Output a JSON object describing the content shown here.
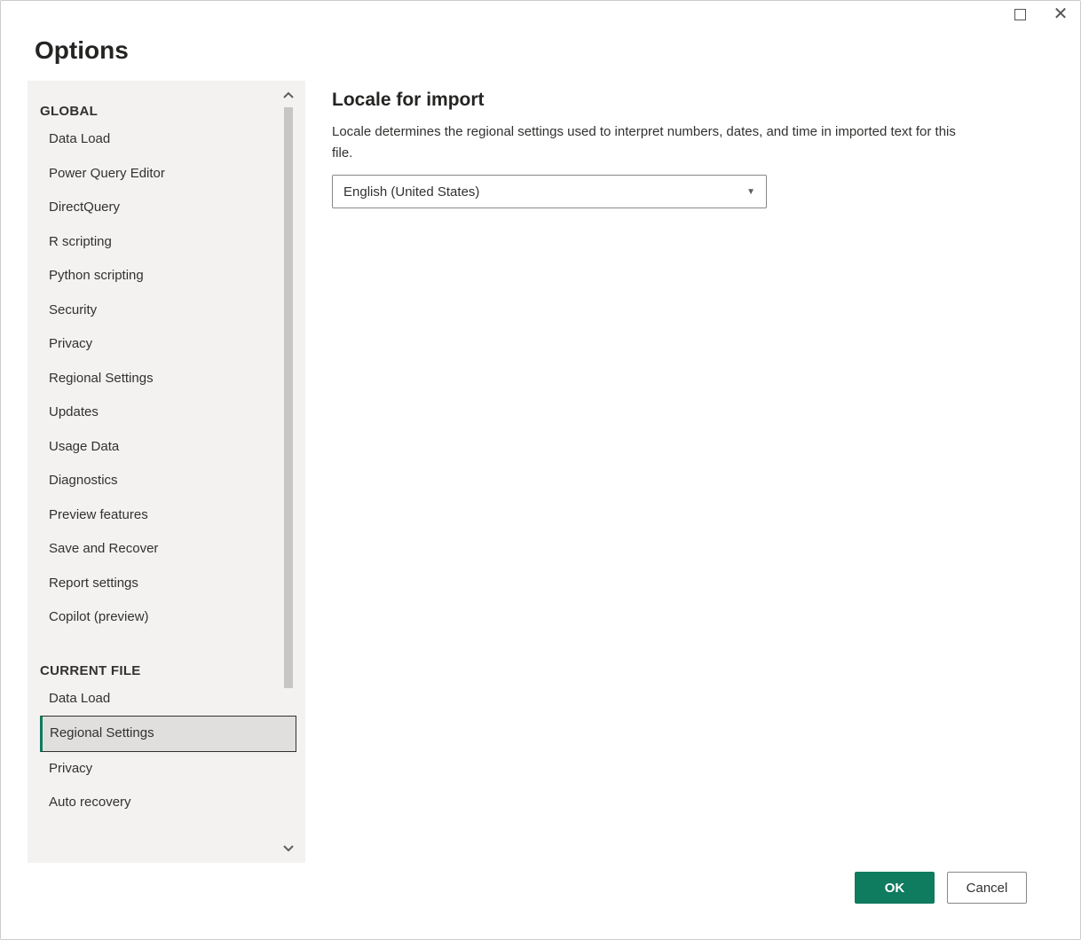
{
  "dialog": {
    "title": "Options"
  },
  "sidebar": {
    "sections": [
      {
        "header": "GLOBAL",
        "items": [
          "Data Load",
          "Power Query Editor",
          "DirectQuery",
          "R scripting",
          "Python scripting",
          "Security",
          "Privacy",
          "Regional Settings",
          "Updates",
          "Usage Data",
          "Diagnostics",
          "Preview features",
          "Save and Recover",
          "Report settings",
          "Copilot (preview)"
        ]
      },
      {
        "header": "CURRENT FILE",
        "items": [
          "Data Load",
          "Regional Settings",
          "Privacy",
          "Auto recovery"
        ]
      }
    ],
    "selected": "Regional Settings",
    "selected_section": 1
  },
  "content": {
    "heading": "Locale for import",
    "description": "Locale determines the regional settings used to interpret numbers, dates, and time in imported text for this file.",
    "locale_value": "English (United States)"
  },
  "footer": {
    "ok": "OK",
    "cancel": "Cancel"
  }
}
